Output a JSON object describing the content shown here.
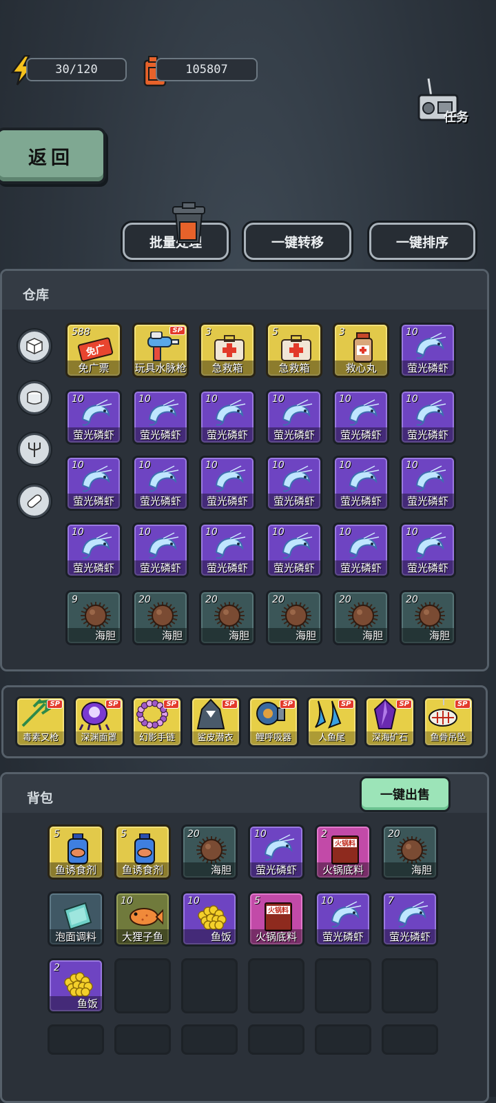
{
  "resources": {
    "energy": "30/120",
    "fuel": "105807"
  },
  "task_label": "任务",
  "back_label": "返回",
  "actions": {
    "batch_process": "批量处理",
    "transfer_all": "一键转移",
    "sort_all": "一键排序"
  },
  "warehouse": {
    "title": "仓库",
    "items": [
      {
        "count": "588",
        "label": "免广票",
        "color": "yellow",
        "icon": "ticket",
        "sp": false
      },
      {
        "count": "",
        "label": "玩具水脉枪",
        "color": "yellow",
        "icon": "water-gun",
        "sp": true
      },
      {
        "count": "3",
        "label": "急救箱",
        "color": "yellow",
        "icon": "medkit",
        "sp": false
      },
      {
        "count": "5",
        "label": "急救箱",
        "color": "yellow",
        "icon": "medkit",
        "sp": false
      },
      {
        "count": "3",
        "label": "救心丸",
        "color": "yellow",
        "icon": "pill-bottle",
        "sp": false
      },
      {
        "count": "10",
        "label": "萤光磷虾",
        "color": "purple",
        "icon": "shrimp",
        "sp": false
      },
      {
        "count": "10",
        "label": "萤光磷虾",
        "color": "purple",
        "icon": "shrimp",
        "sp": false
      },
      {
        "count": "10",
        "label": "萤光磷虾",
        "color": "purple",
        "icon": "shrimp",
        "sp": false
      },
      {
        "count": "10",
        "label": "萤光磷虾",
        "color": "purple",
        "icon": "shrimp",
        "sp": false
      },
      {
        "count": "10",
        "label": "萤光磷虾",
        "color": "purple",
        "icon": "shrimp",
        "sp": false
      },
      {
        "count": "10",
        "label": "萤光磷虾",
        "color": "purple",
        "icon": "shrimp",
        "sp": false
      },
      {
        "count": "10",
        "label": "萤光磷虾",
        "color": "purple",
        "icon": "shrimp",
        "sp": false
      },
      {
        "count": "10",
        "label": "萤光磷虾",
        "color": "purple",
        "icon": "shrimp",
        "sp": false
      },
      {
        "count": "10",
        "label": "萤光磷虾",
        "color": "purple",
        "icon": "shrimp",
        "sp": false
      },
      {
        "count": "10",
        "label": "萤光磷虾",
        "color": "purple",
        "icon": "shrimp",
        "sp": false
      },
      {
        "count": "10",
        "label": "萤光磷虾",
        "color": "purple",
        "icon": "shrimp",
        "sp": false
      },
      {
        "count": "10",
        "label": "萤光磷虾",
        "color": "purple",
        "icon": "shrimp",
        "sp": false
      },
      {
        "count": "10",
        "label": "萤光磷虾",
        "color": "purple",
        "icon": "shrimp",
        "sp": false
      },
      {
        "count": "10",
        "label": "萤光磷虾",
        "color": "purple",
        "icon": "shrimp",
        "sp": false
      },
      {
        "count": "10",
        "label": "萤光磷虾",
        "color": "purple",
        "icon": "shrimp",
        "sp": false
      },
      {
        "count": "10",
        "label": "萤光磷虾",
        "color": "purple",
        "icon": "shrimp",
        "sp": false
      },
      {
        "count": "10",
        "label": "萤光磷虾",
        "color": "purple",
        "icon": "shrimp",
        "sp": false
      },
      {
        "count": "10",
        "label": "萤光磷虾",
        "color": "purple",
        "icon": "shrimp",
        "sp": false
      },
      {
        "count": "10",
        "label": "萤光磷虾",
        "color": "purple",
        "icon": "shrimp",
        "sp": false
      },
      {
        "count": "9",
        "label": "海胆",
        "color": "teal",
        "icon": "urchin",
        "sp": false
      },
      {
        "count": "20",
        "label": "海胆",
        "color": "teal",
        "icon": "urchin",
        "sp": false
      },
      {
        "count": "20",
        "label": "海胆",
        "color": "teal",
        "icon": "urchin",
        "sp": false
      },
      {
        "count": "20",
        "label": "海胆",
        "color": "teal",
        "icon": "urchin",
        "sp": false
      },
      {
        "count": "20",
        "label": "海胆",
        "color": "teal",
        "icon": "urchin",
        "sp": false
      },
      {
        "count": "20",
        "label": "海胆",
        "color": "teal",
        "icon": "urchin",
        "sp": false
      }
    ]
  },
  "equipment": [
    {
      "label": "毒素叉枪",
      "icon": "trident",
      "sp": true
    },
    {
      "label": "深渊面罩",
      "icon": "abyss-mask",
      "sp": true
    },
    {
      "label": "幻影手链",
      "icon": "bracelet",
      "sp": true
    },
    {
      "label": "鲨皮潜衣",
      "icon": "shark-suit",
      "sp": true
    },
    {
      "label": "鲤呼吸器",
      "icon": "respirator",
      "sp": true
    },
    {
      "label": "人鱼尾",
      "icon": "mermaid-tail",
      "sp": true
    },
    {
      "label": "深海矿石",
      "icon": "crystal",
      "sp": true
    },
    {
      "label": "鱼骨吊坠",
      "icon": "fishbone-pendant",
      "sp": true
    }
  ],
  "backpack": {
    "title": "背包",
    "sell_label": "一键出售",
    "items": [
      {
        "count": "5",
        "label": "鱼诱食剂",
        "color": "yellow",
        "icon": "bait-bottle"
      },
      {
        "count": "5",
        "label": "鱼诱食剂",
        "color": "yellow",
        "icon": "bait-bottle"
      },
      {
        "count": "20",
        "label": "海胆",
        "color": "teal",
        "icon": "urchin"
      },
      {
        "count": "10",
        "label": "萤光磷虾",
        "color": "purple",
        "icon": "shrimp"
      },
      {
        "count": "2",
        "label": "火锅底料",
        "color": "pink",
        "icon": "hotpot-bag"
      },
      {
        "count": "20",
        "label": "海胆",
        "color": "teal",
        "icon": "urchin"
      },
      {
        "count": "",
        "label": "泡面调料",
        "color": "steel",
        "icon": "seasoning-pack"
      },
      {
        "count": "10",
        "label": "大狸子鱼",
        "color": "olive",
        "icon": "fish"
      },
      {
        "count": "10",
        "label": "鱼饭",
        "color": "purple",
        "icon": "fish-rice"
      },
      {
        "count": "5",
        "label": "火锅底料",
        "color": "pink",
        "icon": "hotpot-bag"
      },
      {
        "count": "10",
        "label": "萤光磷虾",
        "color": "purple",
        "icon": "shrimp"
      },
      {
        "count": "7",
        "label": "萤光磷虾",
        "color": "purple",
        "icon": "shrimp"
      },
      {
        "count": "2",
        "label": "鱼饭",
        "color": "purple",
        "icon": "fish-rice"
      }
    ],
    "empty_slots": 11
  },
  "sp_badge": "SP",
  "hotpot_text": "火锅料",
  "ticket_text": "免广"
}
